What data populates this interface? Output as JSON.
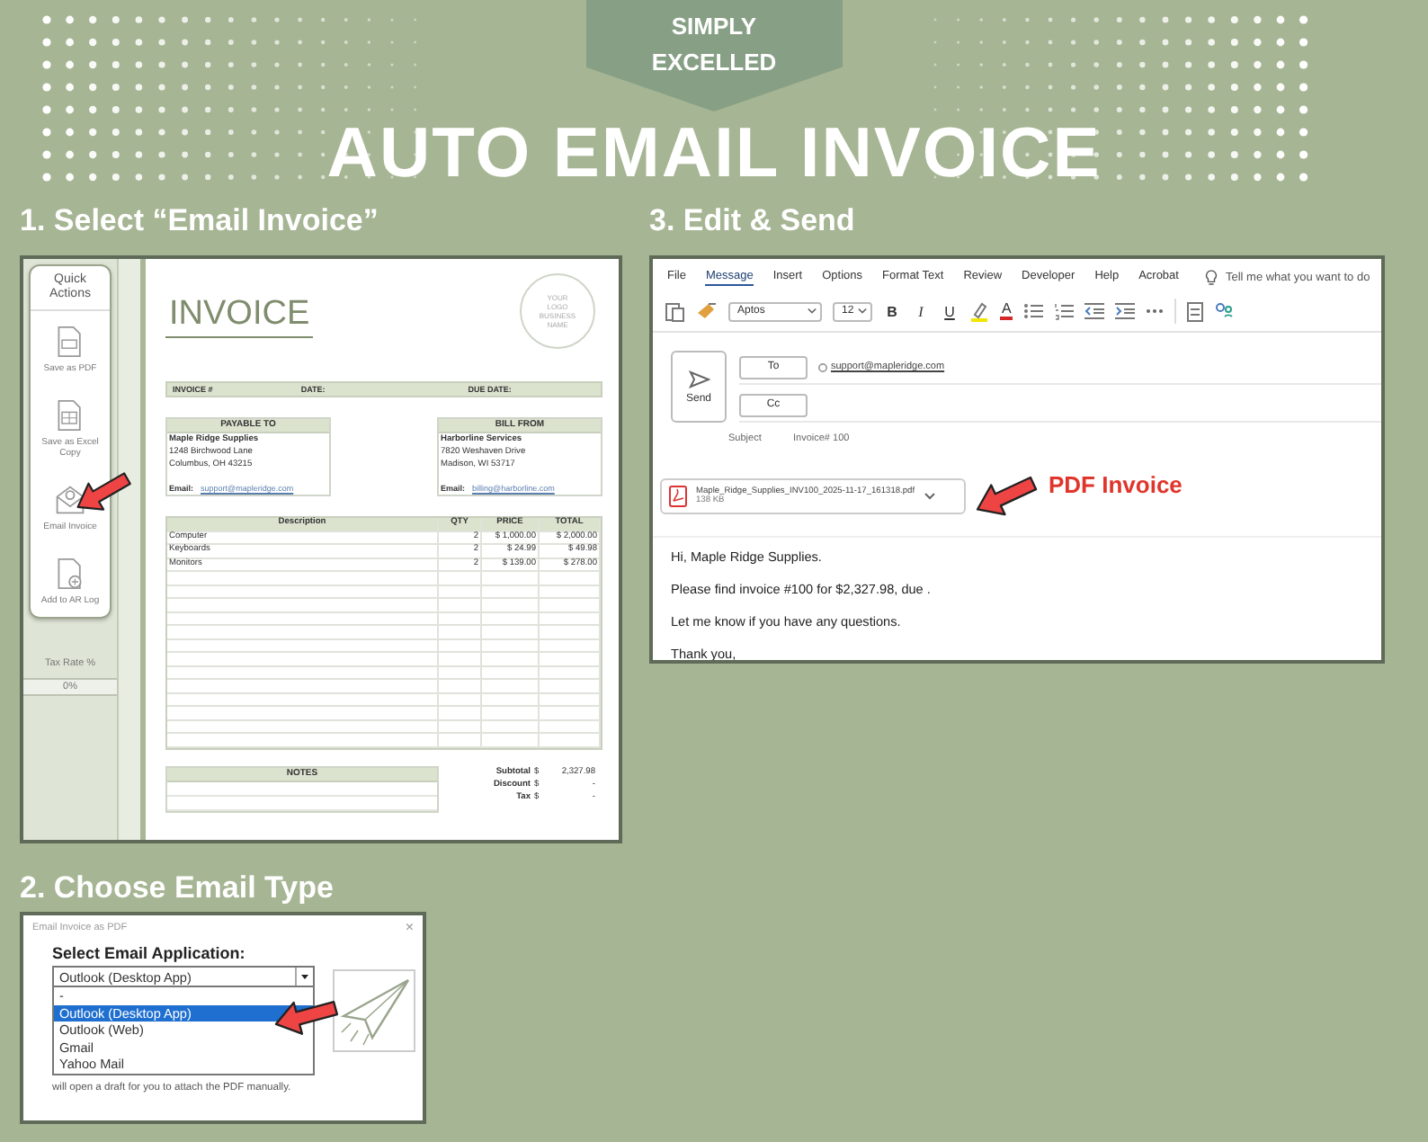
{
  "banner": {
    "brand": "SIMPLY EXCELLED"
  },
  "title": "AUTO EMAIL INVOICE",
  "step_1": {
    "label": "1. Select “Email Invoice”",
    "spreadsheet": {
      "quick_actions": {
        "title": "Quick Actions",
        "actions": [
          {
            "kind": "pdf",
            "label": "Save as PDF",
            "pointed": false
          },
          {
            "kind": "excel",
            "label": "Save as Excel Copy",
            "pointed": false
          },
          {
            "kind": "email",
            "label": "Email Invoice",
            "pointed": true
          },
          {
            "kind": "log",
            "label": "Add to AR Log",
            "pointed": false
          }
        ]
      },
      "tax_rate": {
        "label": "Tax Rate %",
        "value": "0%"
      },
      "invoice": {
        "title": "INVOICE",
        "logo": "YOUR LOGO BUSINESS NAME",
        "fields": [
          "INVOICE #",
          "DATE:",
          "DUE DATE:"
        ],
        "parties": [
          {
            "heading": "PAYABLE TO",
            "name": "Maple Ridge Supplies",
            "lines": [
              "1248 Birchwood Lane",
              "Columbus, OH 43215"
            ],
            "email_label": "Email:",
            "email": "support@mapleridge.com"
          },
          {
            "heading": "BILL FROM",
            "name": "Harborline Services",
            "lines": [
              "7820 Weshaven Drive",
              "Madison, WI 53717"
            ],
            "email_label": "Email:",
            "email": "billing@harborline.com"
          }
        ],
        "columns": [
          "Description",
          "QTY",
          "PRICE",
          "TOTAL"
        ],
        "rows": [
          [
            "Computer",
            "2",
            "$ 1,000.00",
            "$ 2,000.00"
          ],
          [
            "Keyboards",
            "2",
            "$ 24.99",
            "$ 49.98"
          ],
          [
            "Monitors",
            "2",
            "$ 139.00",
            "$ 278.00"
          ]
        ],
        "notes": "NOTES",
        "totals": [
          {
            "label": "Subtotal",
            "currency": "$",
            "value": "2,327.98"
          },
          {
            "label": "Discount",
            "currency": "$",
            "value": "-"
          },
          {
            "label": "Tax",
            "currency": "$",
            "value": "-"
          }
        ]
      }
    }
  },
  "step_3": {
    "label": "3. Edit & Send",
    "email": {
      "tabs": [
        {
          "label": "File",
          "selected": false
        },
        {
          "label": "Message",
          "selected": true
        },
        {
          "label": "Insert",
          "selected": false
        },
        {
          "label": "Options",
          "selected": false
        },
        {
          "label": "Format Text",
          "selected": false
        },
        {
          "label": "Review",
          "selected": false
        },
        {
          "label": "Developer",
          "selected": false
        },
        {
          "label": "Help",
          "selected": false
        },
        {
          "label": "Acrobat",
          "selected": false
        }
      ],
      "tell_me": "Tell me what you want to do",
      "font": "Aptos",
      "font_size": "12",
      "format_buttons": [
        "B",
        "I",
        "U"
      ],
      "font_color": "A",
      "send": "Send",
      "to": "To",
      "cc": "Cc",
      "recipient": "support@mapleridge.com",
      "subject_label": "Subject",
      "subject": "Invoice# 100",
      "attachment": {
        "name": "Maple_Ridge_Supplies_INV100_2025-11-17_161318.pdf",
        "size": "138 KB"
      },
      "callout": "PDF Invoice",
      "body": [
        "Hi, Maple Ridge Supplies.",
        "Please find invoice #100 for $2,327.98, due .",
        "Let me know if you have any questions.",
        "Thank you,"
      ]
    }
  },
  "step_2": {
    "label": "2. Choose Email Type",
    "dialog": {
      "title": "Email Invoice as PDF",
      "close": "×",
      "prompt": "Select Email Application:",
      "value": "Outlook (Desktop App)",
      "options": [
        {
          "label": "-",
          "selected": false
        },
        {
          "label": "Outlook (Desktop App)",
          "selected": true
        },
        {
          "label": "Outlook (Web)",
          "selected": false
        },
        {
          "label": "Gmail",
          "selected": false
        },
        {
          "label": "Yahoo Mail",
          "selected": false
        }
      ],
      "hint": "will open a draft for you to attach the PDF manually."
    }
  }
}
